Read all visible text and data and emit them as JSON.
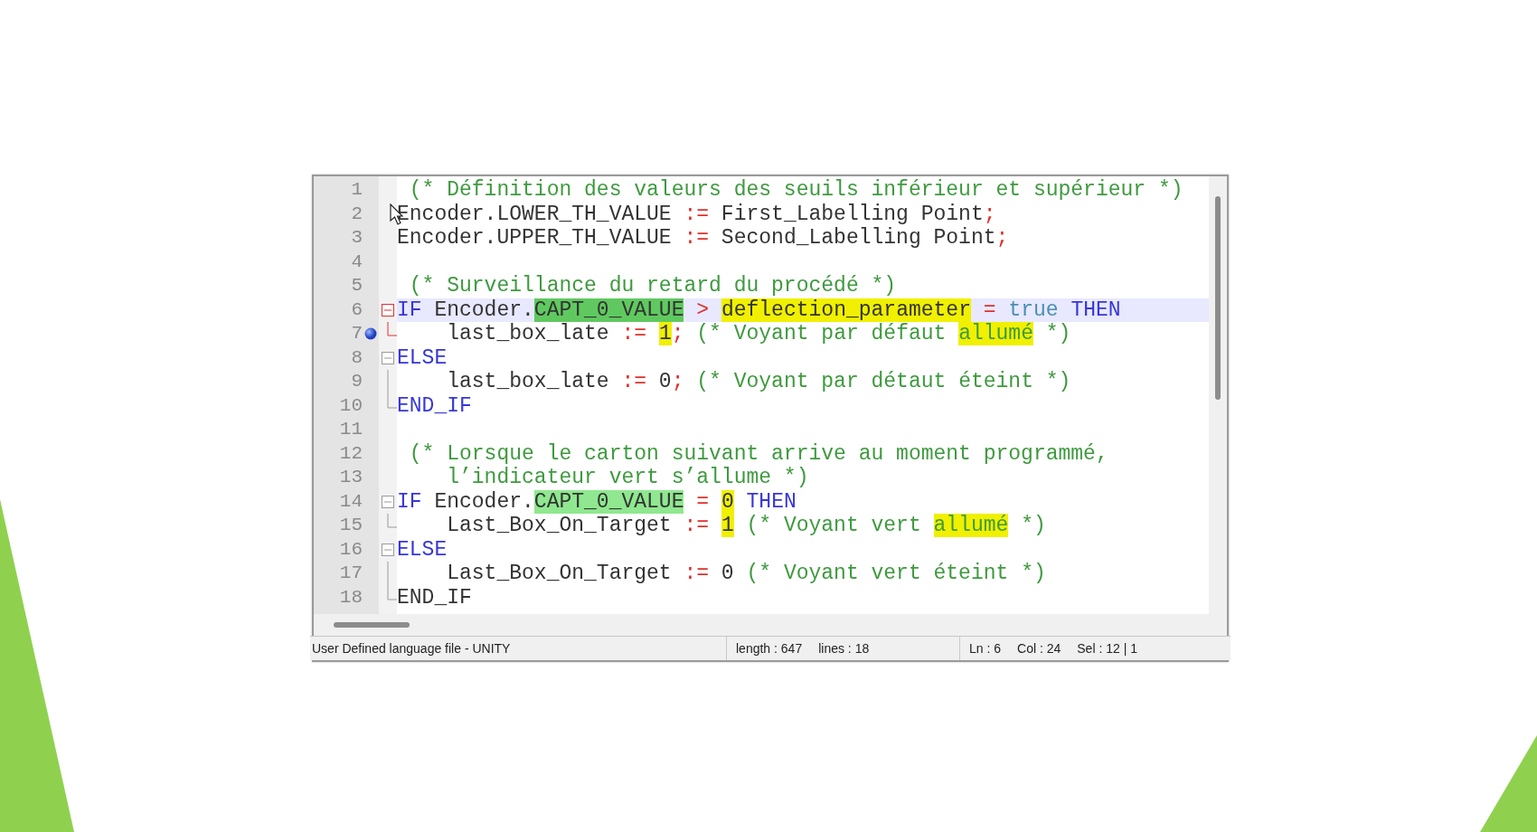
{
  "editor": {
    "lines": [
      {
        "number": "1",
        "tokens": [
          {
            "text": " (* Définition des valeurs des seuils inférieur et supérieur *)",
            "kind": "comment"
          }
        ]
      },
      {
        "number": "2",
        "tokens": [
          {
            "text": "Encoder.LOWER_TH_VALUE ",
            "kind": "plain"
          },
          {
            "text": ":=",
            "kind": "operator"
          },
          {
            "text": " First_Labelling Point",
            "kind": "plain"
          },
          {
            "text": ";",
            "kind": "operator"
          }
        ]
      },
      {
        "number": "3",
        "tokens": [
          {
            "text": "Encoder.UPPER_TH_VALUE ",
            "kind": "plain"
          },
          {
            "text": ":=",
            "kind": "operator"
          },
          {
            "text": " Second_Labelling Point",
            "kind": "plain"
          },
          {
            "text": ";",
            "kind": "operator"
          }
        ]
      },
      {
        "number": "4"
      },
      {
        "number": "5",
        "tokens": [
          {
            "text": " (* Surveillance du retard du procédé *)",
            "kind": "comment"
          }
        ]
      },
      {
        "number": "6",
        "current": true,
        "fold": {
          "kind": "start",
          "active": true
        },
        "tokens": [
          {
            "text": "IF",
            "kind": "keyword"
          },
          {
            "text": " Encoder.",
            "kind": "plain"
          },
          {
            "text": "CAPT_0_VALUE",
            "kind": "plain",
            "smart_highlight": true
          },
          {
            "text": " > ",
            "kind": "operator"
          },
          {
            "text": "deflection_parameter",
            "kind": "plain",
            "find_mark": true
          },
          {
            "text": " = ",
            "kind": "operator"
          },
          {
            "text": "true ",
            "kind": "constant"
          },
          {
            "text": "THEN",
            "kind": "keyword"
          }
        ]
      },
      {
        "number": "7",
        "bookmark": true,
        "fold": {
          "kind": "end",
          "active": true
        },
        "tokens": [
          {
            "text": "    last_box_late ",
            "kind": "plain"
          },
          {
            "text": ":= ",
            "kind": "operator"
          },
          {
            "text": "1",
            "kind": "plain",
            "find_mark": true
          },
          {
            "text": ";",
            "kind": "operator"
          },
          {
            "text": " (* Voyant par défaut ",
            "kind": "comment"
          },
          {
            "text": "allumé",
            "kind": "comment",
            "find_mark": true
          },
          {
            "text": " *)",
            "kind": "comment"
          }
        ]
      },
      {
        "number": "8",
        "fold": {
          "kind": "start",
          "active": false
        },
        "tokens": [
          {
            "text": "ELSE",
            "kind": "keyword"
          }
        ]
      },
      {
        "number": "9",
        "fold": {
          "kind": "line",
          "active": false
        },
        "tokens": [
          {
            "text": "    last_box_late ",
            "kind": "plain"
          },
          {
            "text": ":=",
            "kind": "operator"
          },
          {
            "text": " 0",
            "kind": "plain"
          },
          {
            "text": ";",
            "kind": "operator"
          },
          {
            "text": " (* Voyant par détaut éteint *)",
            "kind": "comment"
          }
        ]
      },
      {
        "number": "10",
        "fold": {
          "kind": "end",
          "active": false
        },
        "tokens": [
          {
            "text": "END_IF",
            "kind": "keyword"
          }
        ]
      },
      {
        "number": "11"
      },
      {
        "number": "12",
        "tokens": [
          {
            "text": " (* Lorsque le carton suivant arrive au moment programmé,",
            "kind": "comment"
          }
        ]
      },
      {
        "number": "13",
        "tokens": [
          {
            "text": "    l’indicateur vert s’allume *)",
            "kind": "comment"
          }
        ]
      },
      {
        "number": "14",
        "fold": {
          "kind": "start",
          "active": false
        },
        "tokens": [
          {
            "text": "IF",
            "kind": "keyword"
          },
          {
            "text": " Encoder.",
            "kind": "plain"
          },
          {
            "text": "CAPT_0_VALUE",
            "kind": "plain",
            "smart_highlight": true
          },
          {
            "text": " = ",
            "kind": "operator"
          },
          {
            "text": "0",
            "kind": "plain",
            "find_mark": true
          },
          {
            "text": " THEN",
            "kind": "keyword"
          }
        ]
      },
      {
        "number": "15",
        "fold": {
          "kind": "end",
          "active": false
        },
        "tokens": [
          {
            "text": "    Last_Box_On_Target ",
            "kind": "plain"
          },
          {
            "text": ":= ",
            "kind": "operator"
          },
          {
            "text": "1",
            "kind": "plain",
            "find_mark": true
          },
          {
            "text": " (* Voyant vert ",
            "kind": "comment"
          },
          {
            "text": "allumé",
            "kind": "comment",
            "find_mark": true
          },
          {
            "text": " *)",
            "kind": "comment"
          }
        ]
      },
      {
        "number": "16",
        "fold": {
          "kind": "start",
          "active": false
        },
        "tokens": [
          {
            "text": "ELSE",
            "kind": "keyword"
          }
        ]
      },
      {
        "number": "17",
        "fold": {
          "kind": "line",
          "active": false
        },
        "tokens": [
          {
            "text": "    Last_Box_On_Target ",
            "kind": "plain"
          },
          {
            "text": ":=",
            "kind": "operator"
          },
          {
            "text": " 0 ",
            "kind": "plain"
          },
          {
            "text": "(* Voyant vert éteint *)",
            "kind": "comment"
          }
        ]
      },
      {
        "number": "18",
        "fold": {
          "kind": "end",
          "active": false
        },
        "tokens": [
          {
            "text": "END_IF",
            "kind": "plain"
          }
        ]
      }
    ]
  },
  "status_bar": {
    "language": "User Defined language file - UNITY",
    "length": "length : 647",
    "lines": "lines : 18",
    "line": "Ln : 6",
    "column": "Col : 24",
    "selection": "Sel : 12 | 1"
  }
}
